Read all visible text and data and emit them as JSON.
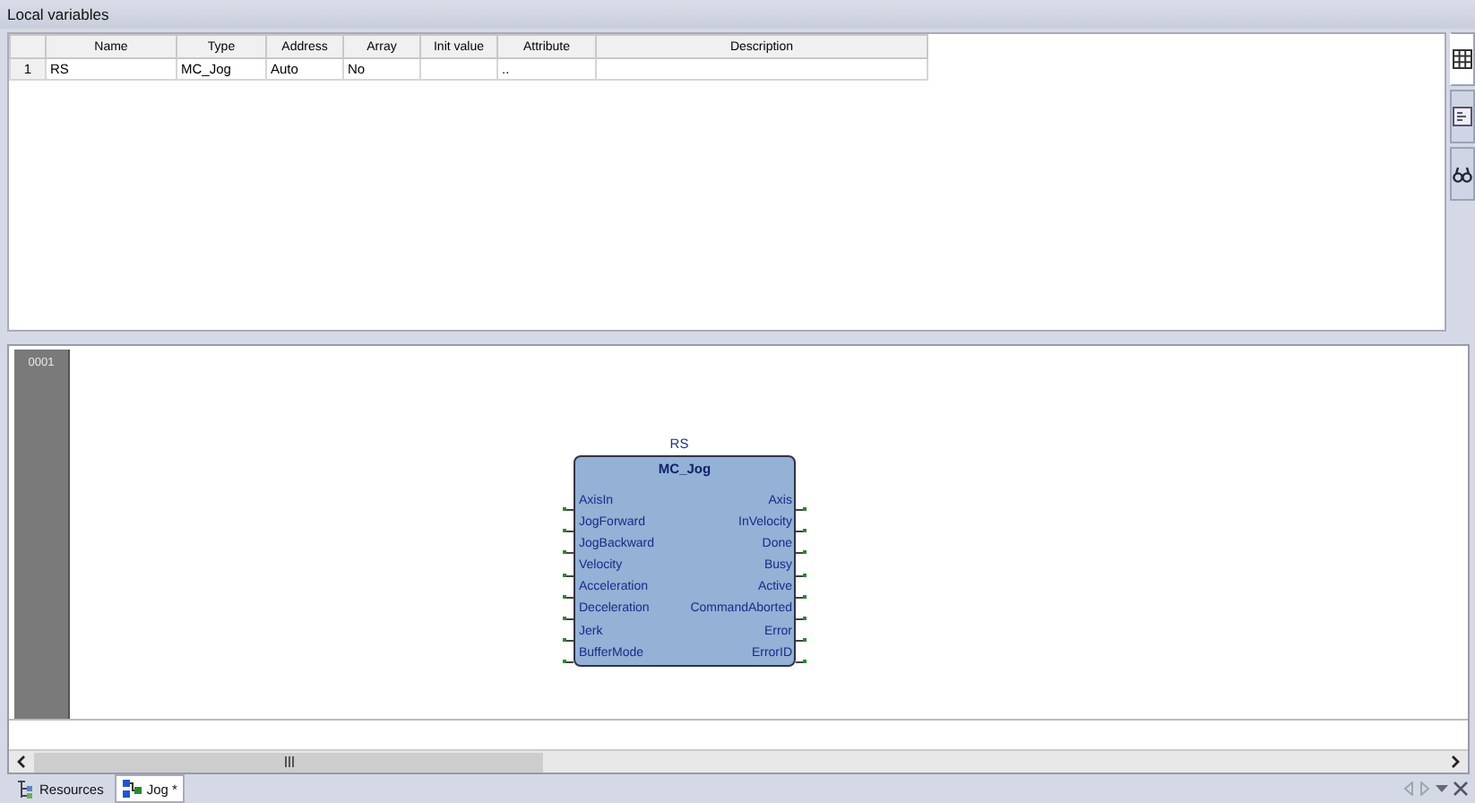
{
  "panel": {
    "title": "Local variables"
  },
  "table": {
    "columns": [
      "Name",
      "Type",
      "Address",
      "Array",
      "Init value",
      "Attribute",
      "Description"
    ],
    "rows": [
      {
        "number": "1",
        "cells": [
          "RS",
          "MC_Jog",
          "Auto",
          "No",
          "",
          "..",
          ""
        ]
      }
    ]
  },
  "side_tabs": [
    {
      "kind": "grid",
      "selected": true
    },
    {
      "kind": "form",
      "selected": false
    },
    {
      "kind": "binoculars",
      "selected": false
    }
  ],
  "diagram": {
    "rung": "0001",
    "block": {
      "instance": "RS",
      "type": "MC_Jog",
      "inputs": [
        "AxisIn",
        "JogForward",
        "JogBackward",
        "Velocity",
        "Acceleration",
        "Deceleration",
        "Jerk",
        "BufferMode"
      ],
      "outputs": [
        "Axis",
        "InVelocity",
        "Done",
        "Busy",
        "Active",
        "CommandAborted",
        "Error",
        "ErrorID"
      ]
    }
  },
  "bottom_tabs": [
    {
      "label": "Resources",
      "kind": "resources",
      "selected": false
    },
    {
      "label": "Jog *",
      "kind": "program",
      "selected": true
    }
  ]
}
